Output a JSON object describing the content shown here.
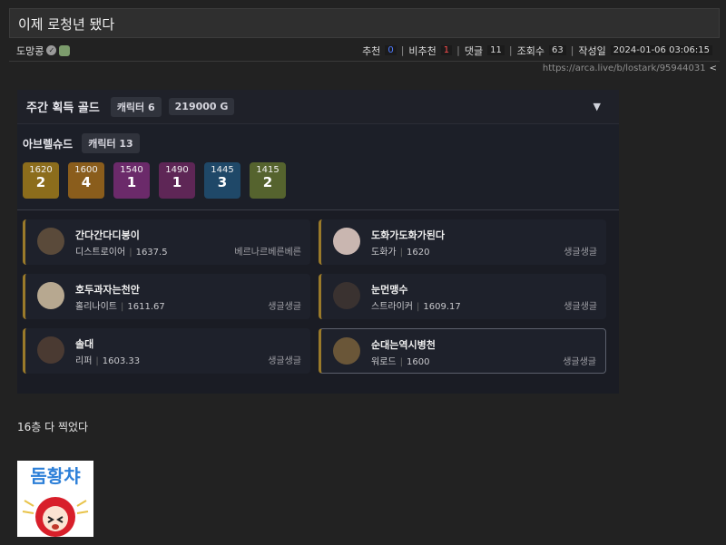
{
  "post": {
    "title": "이제 로청년 됐다",
    "author": "도망콩",
    "stats": {
      "upvote_label": "추천",
      "upvote_value": "0",
      "downvote_label": "비추천",
      "downvote_value": "1",
      "comments_label": "댓글",
      "comments_value": "11",
      "views_label": "조회수",
      "views_value": "63",
      "date_label": "작성일",
      "date_value": "2024-01-06 03:06:15"
    },
    "url": "https://arca.live/b/lostark/95944031",
    "body_text": "16층 다 찍었다"
  },
  "embed": {
    "header": {
      "title": "주간 획득 골드",
      "chip_characters": "캐릭터 6",
      "chip_gold": "219000 G"
    },
    "server": {
      "name": "아브렐슈드",
      "chip": "캐릭터 13"
    },
    "levels": [
      {
        "level": "1620",
        "count": "2",
        "color": "#8c6d1c"
      },
      {
        "level": "1600",
        "count": "4",
        "color": "#8a5d1c"
      },
      {
        "level": "1540",
        "count": "1",
        "color": "#6b2a6a"
      },
      {
        "level": "1490",
        "count": "1",
        "color": "#5e2656"
      },
      {
        "level": "1445",
        "count": "3",
        "color": "#1f4868"
      },
      {
        "level": "1415",
        "count": "2",
        "color": "#55632e"
      }
    ],
    "characters": [
      {
        "name": "간다간다디붕이",
        "class": "디스트로이어",
        "ilvl": "1637.5",
        "guild": "베르나르베른베른"
      },
      {
        "name": "도화가도화가된다",
        "class": "도화가",
        "ilvl": "1620",
        "guild": "생글생글"
      },
      {
        "name": "호두과자는천안",
        "class": "홀리나이트",
        "ilvl": "1611.67",
        "guild": "생글생글"
      },
      {
        "name": "눈먼맹수",
        "class": "스트라이커",
        "ilvl": "1609.17",
        "guild": "생글생글"
      },
      {
        "name": "솔대",
        "class": "리퍼",
        "ilvl": "1603.33",
        "guild": "생글생글"
      },
      {
        "name": "순대는역시병천",
        "class": "워로드",
        "ilvl": "1600",
        "guild": "생글생글"
      }
    ]
  },
  "sticker": {
    "text": "돔황챠"
  }
}
